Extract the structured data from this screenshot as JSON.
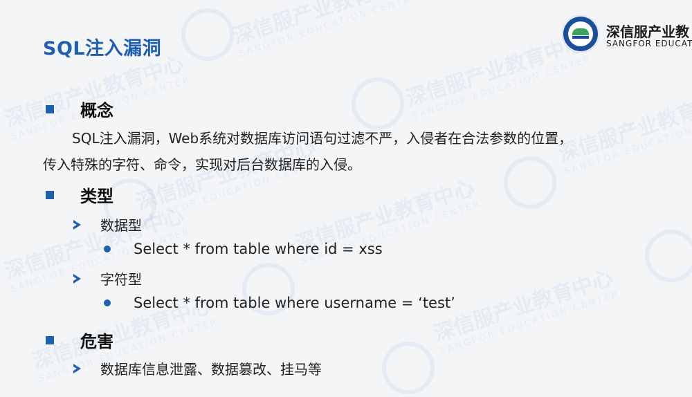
{
  "title": "SQL注入漏洞",
  "logo": {
    "org_cn": "深信服产业教",
    "org_en": "SANGFOR EDUCATIO",
    "badge_text": "SANGFOR EDUCATION CENTER"
  },
  "sections": {
    "concept": {
      "heading": "概念",
      "para_line1": "SQL注入漏洞，Web系统对数据库访问语句过滤不严，入侵者在合法参数的位置，",
      "para_line2": "传入特殊的字符、命令，实现对后台数据库的入侵。"
    },
    "types": {
      "heading": "类型",
      "numeric_label": "数据型",
      "numeric_example": "Select * from table where id = xss",
      "string_label": "字符型",
      "string_example": "Select * from table where username = ‘test’"
    },
    "harm": {
      "heading": "危害",
      "item": "数据库信息泄露、数据篡改、挂马等"
    }
  },
  "watermark": {
    "cn": "深信服产业教育中心",
    "en": "SANGFOR EDUCATION CENTER"
  },
  "colors": {
    "accent": "#1f5fb0",
    "text": "#222222",
    "background": "#f4f5f7"
  }
}
